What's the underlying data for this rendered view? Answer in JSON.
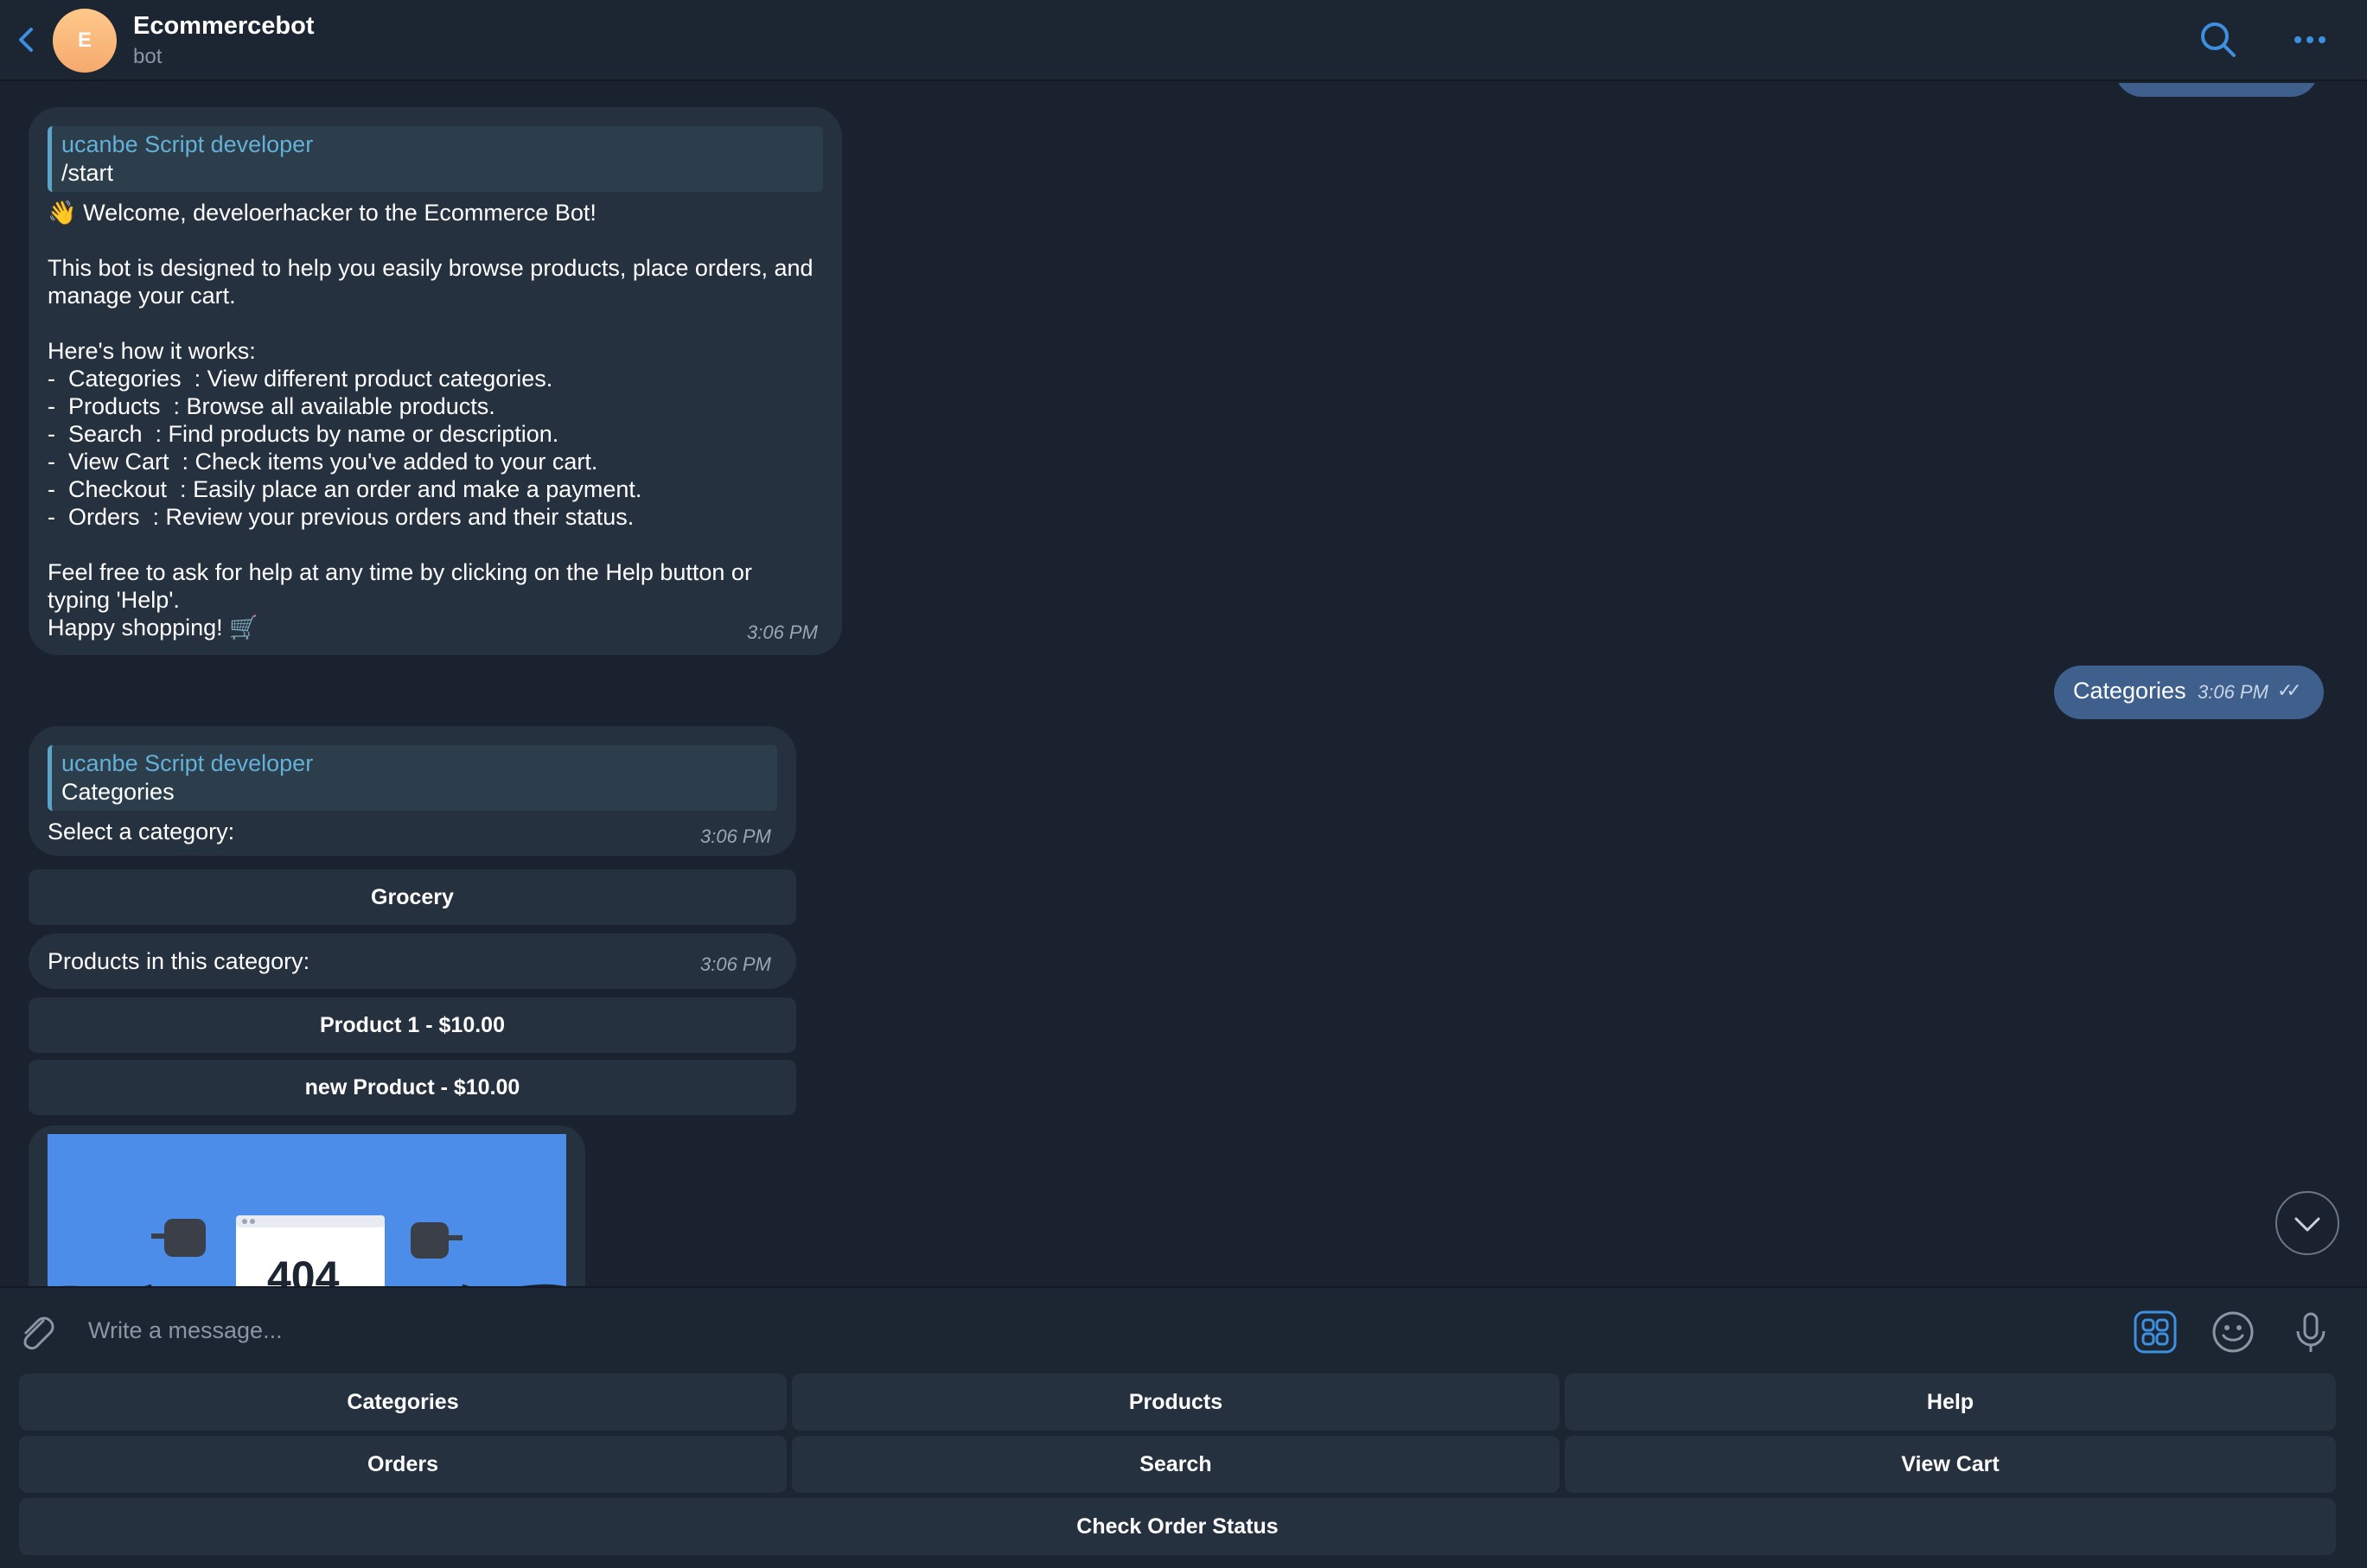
{
  "header": {
    "avatar_letter": "E",
    "title": "Ecommercebot",
    "subtitle": "bot"
  },
  "messages": {
    "welcome": {
      "reply_name": "ucanbe Script developer",
      "reply_text": "/start",
      "text": "👋 Welcome, develoerhacker to the Ecommerce Bot!\n\nThis bot is designed to help you easily browse products, place orders, and\nmanage your cart.\n\nHere's how it works:\n-  Categories  : View different product categories.\n-  Products  : Browse all available products.\n-  Search  : Find products by name or description.\n-  View Cart  : Check items you've added to your cart.\n-  Checkout  : Easily place an order and make a payment.\n-  Orders  : Review your previous orders and their status.\n\nFeel free to ask for help at any time by clicking on the Help button or\ntyping 'Help'.\nHappy shopping! 🛒",
      "time": "3:06 PM"
    },
    "outgoing": {
      "text": "Categories",
      "time": "3:06 PM",
      "status": "✓✓"
    },
    "category_prompt": {
      "reply_name": "ucanbe Script developer",
      "reply_text": "Categories",
      "text": "Select a category:",
      "time": "3:06 PM"
    },
    "category_button": "Grocery",
    "products_msg": {
      "text": "Products in this category:",
      "time": "3:06 PM"
    },
    "product_buttons": [
      "Product 1 - $10.00",
      "new Product - $10.00"
    ],
    "image_text": "404"
  },
  "input": {
    "placeholder": "Write a message..."
  },
  "keyboard": {
    "row1": [
      "Categories",
      "Products",
      "Help"
    ],
    "row2": [
      "Orders",
      "Search",
      "View Cart"
    ],
    "row3": [
      "Check Order Status"
    ]
  },
  "colors": {
    "background": "#1a2230",
    "bubble_in": "#263140",
    "bubble_out": "#3f5f8c",
    "accent": "#3d8fe0",
    "reply_name": "#64b0d6"
  }
}
